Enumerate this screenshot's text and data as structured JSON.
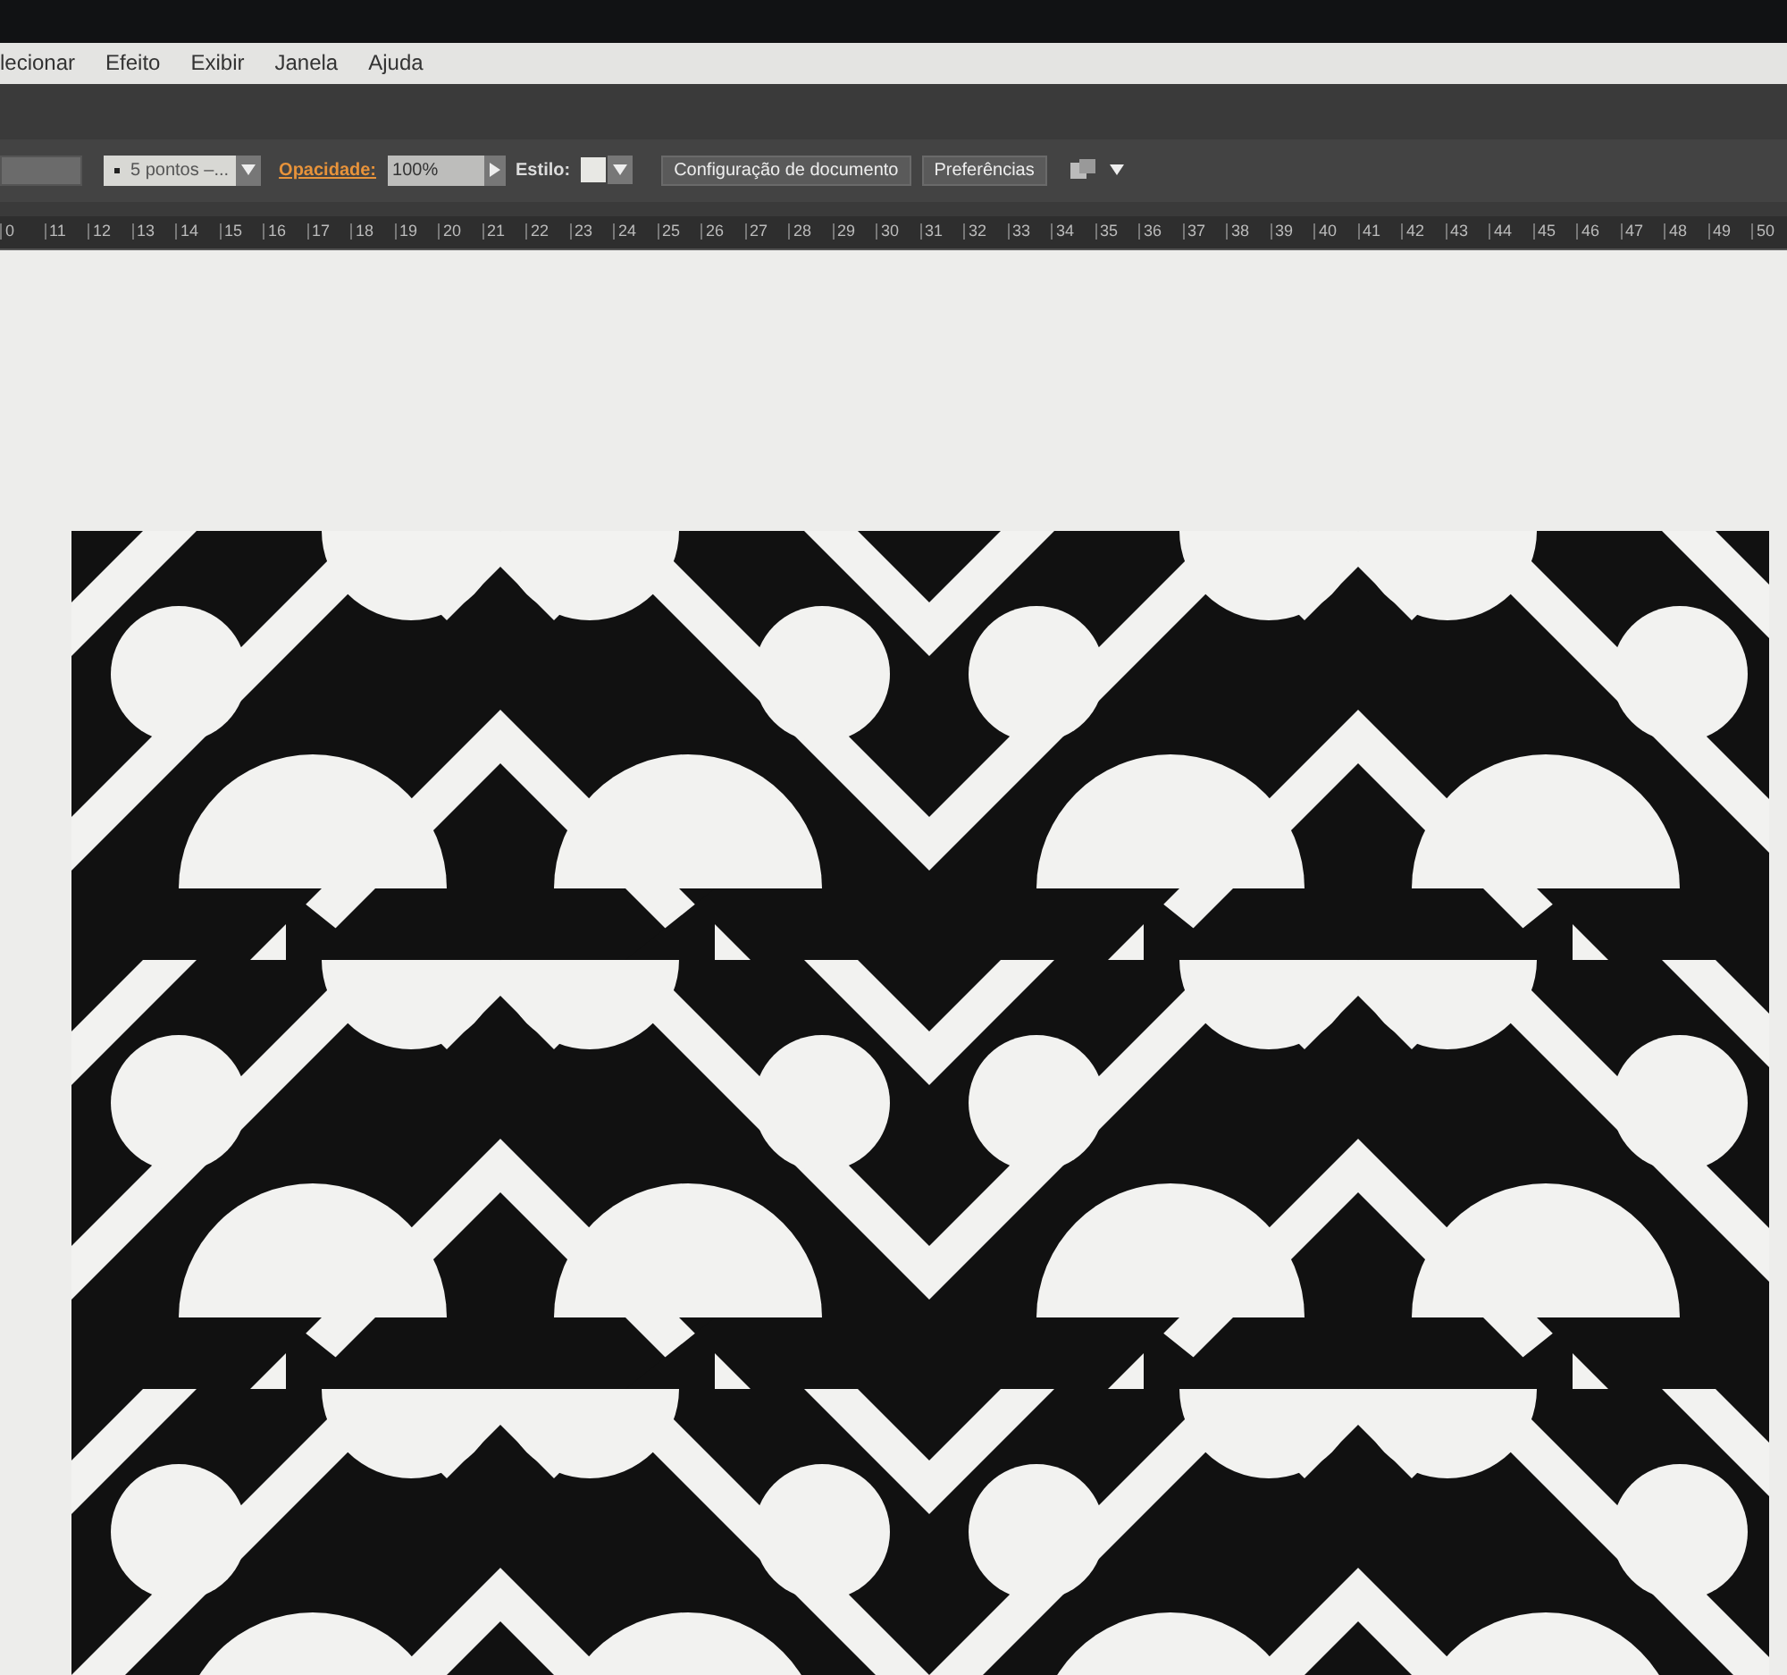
{
  "menu": [
    "lecionar",
    "Efeito",
    "Exibir",
    "Janela",
    "Ajuda"
  ],
  "control_bar": {
    "brush": {
      "value": "5 pontos –..."
    },
    "opacity": {
      "label": "Opacidade:",
      "value": "100%"
    },
    "style": {
      "label": "Estilo:"
    },
    "buttons": [
      "Configuração de documento",
      "Preferências"
    ]
  },
  "ruler": [
    "0",
    "11",
    "12",
    "13",
    "14",
    "15",
    "16",
    "17",
    "18",
    "19",
    "20",
    "21",
    "22",
    "23",
    "24",
    "25",
    "26",
    "27",
    "28",
    "29",
    "30",
    "31",
    "32",
    "33",
    "34",
    "35",
    "36",
    "37",
    "38",
    "39",
    "40",
    "41",
    "42",
    "43",
    "44",
    "45",
    "46",
    "47",
    "48",
    "49",
    "50"
  ]
}
